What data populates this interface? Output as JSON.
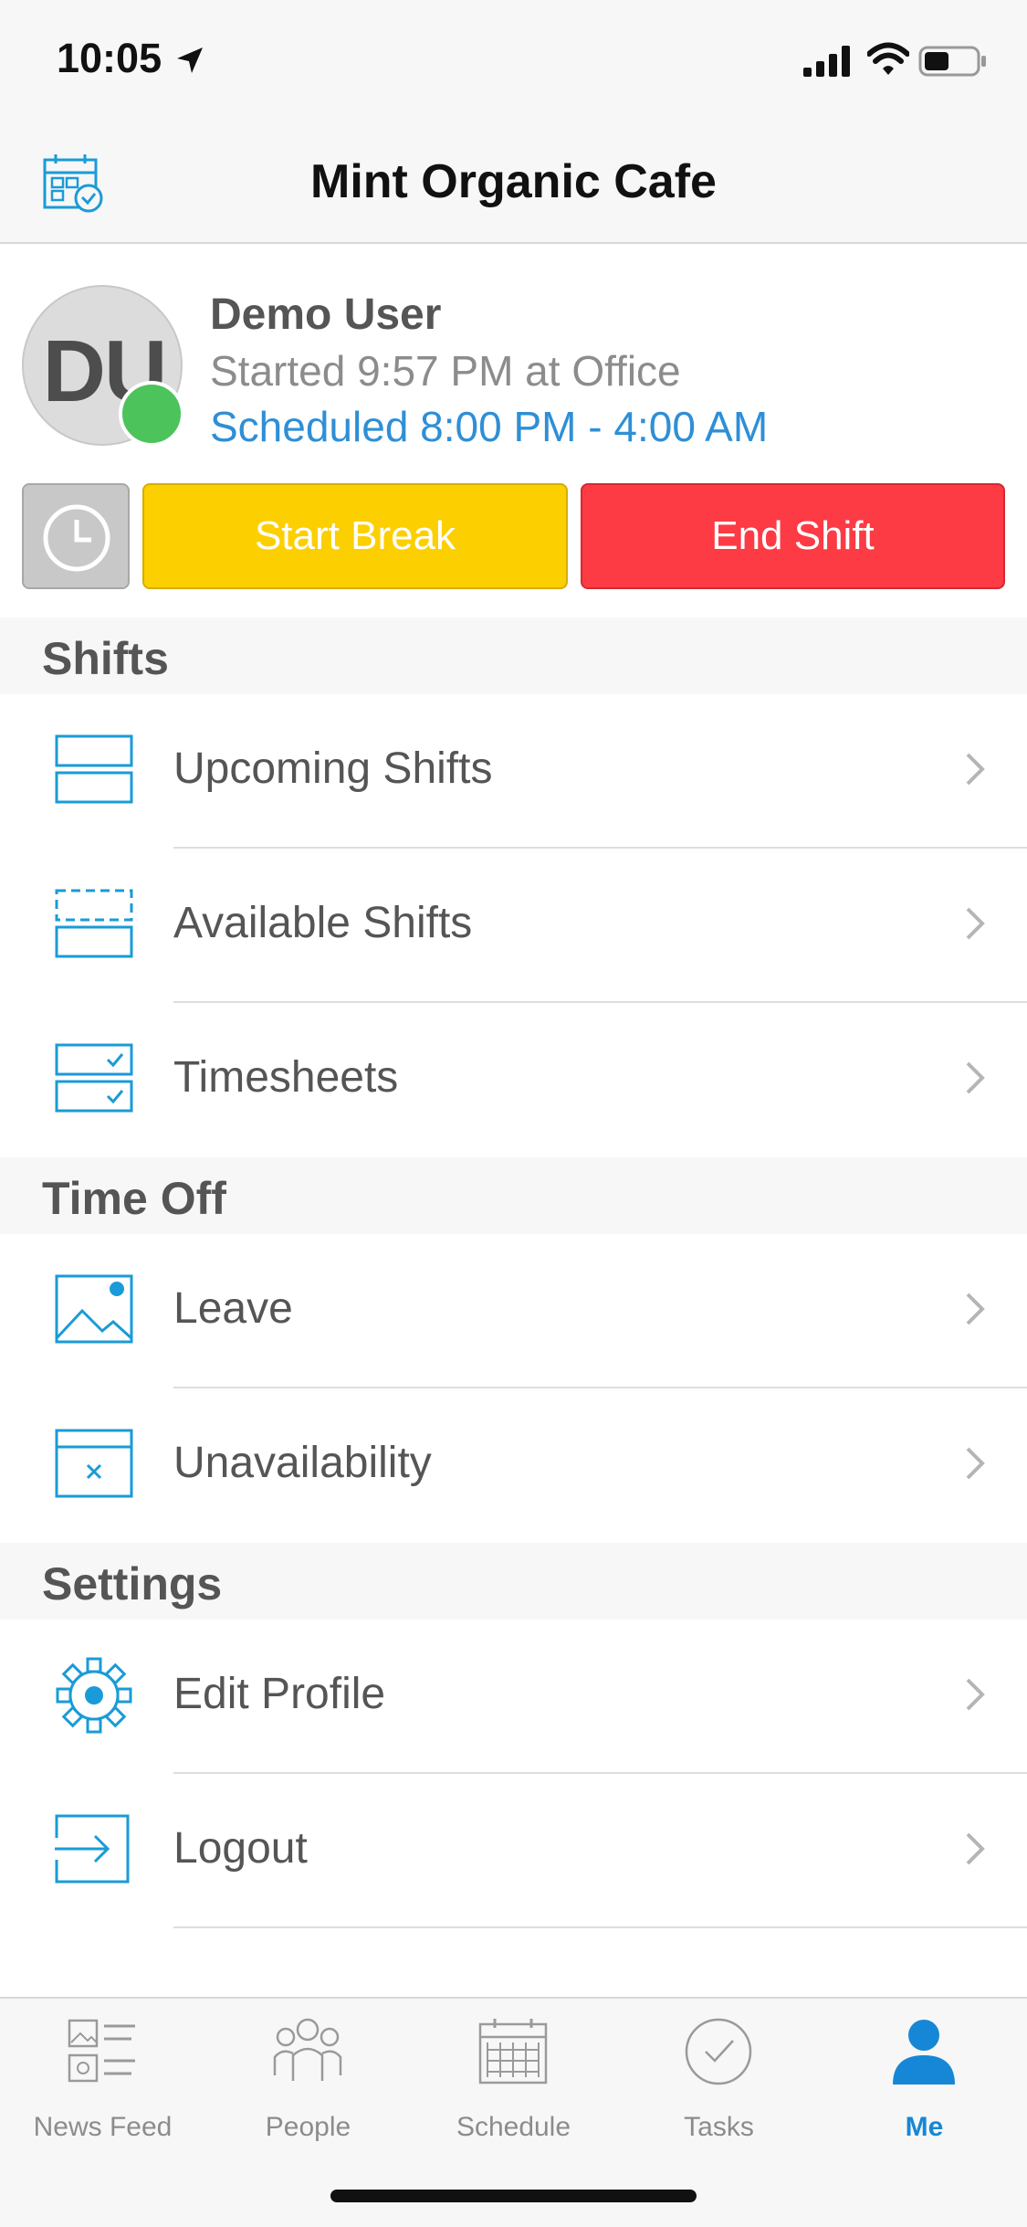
{
  "status": {
    "time": "10:05"
  },
  "header": {
    "title": "Mint Organic Cafe",
    "logo_icon": "calendar-grid-icon"
  },
  "profile": {
    "initials": "DU",
    "name": "Demo User",
    "started": "Started 9:57 PM at Office",
    "scheduled": "Scheduled 8:00 PM - 4:00 AM",
    "status": "online"
  },
  "actions": {
    "clock_icon": "clock-icon",
    "start_break": "Start Break",
    "end_shift": "End Shift"
  },
  "sections": {
    "shifts": {
      "title": "Shifts",
      "items": [
        {
          "label": "Upcoming Shifts",
          "icon": "upcoming-shifts-icon"
        },
        {
          "label": "Available Shifts",
          "icon": "available-shifts-icon"
        },
        {
          "label": "Timesheets",
          "icon": "timesheets-icon"
        }
      ]
    },
    "time_off": {
      "title": "Time Off",
      "items": [
        {
          "label": "Leave",
          "icon": "leave-icon"
        },
        {
          "label": "Unavailability",
          "icon": "unavailability-icon"
        }
      ]
    },
    "settings": {
      "title": "Settings",
      "items": [
        {
          "label": "Edit Profile",
          "icon": "gear-icon"
        },
        {
          "label": "Logout",
          "icon": "logout-icon"
        }
      ]
    }
  },
  "tabs": [
    {
      "label": "News Feed",
      "icon": "news-feed-icon",
      "active": false
    },
    {
      "label": "People",
      "icon": "people-icon",
      "active": false
    },
    {
      "label": "Schedule",
      "icon": "schedule-icon",
      "active": false
    },
    {
      "label": "Tasks",
      "icon": "tasks-icon",
      "active": false
    },
    {
      "label": "Me",
      "icon": "me-icon",
      "active": true
    }
  ],
  "colors": {
    "accent": "#1687d6",
    "link": "#2e8fd6",
    "break_button": "#fccf00",
    "end_button": "#fc3b44",
    "online": "#4dc35b",
    "icon_blue": "#1a9bd7"
  }
}
